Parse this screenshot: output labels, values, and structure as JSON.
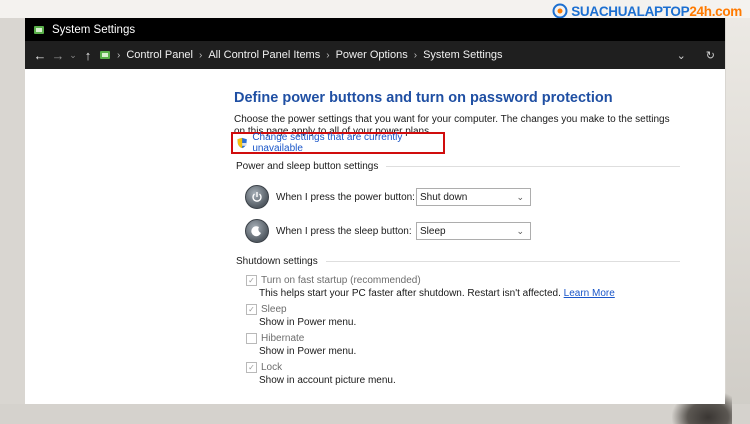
{
  "window": {
    "title": "System Settings"
  },
  "address": {
    "crumbs": [
      "Control Panel",
      "All Control Panel Items",
      "Power Options",
      "System Settings"
    ]
  },
  "page": {
    "heading": "Define power buttons and turn on password protection",
    "description": "Choose the power settings that you want for your computer. The changes you make to the settings on this page apply to all of your power plans.",
    "change_link": "Change settings that are currently unavailable"
  },
  "power_section": {
    "title": "Power and sleep button settings",
    "power_label": "When I press the power button:",
    "power_value": "Shut down",
    "sleep_label": "When I press the sleep button:",
    "sleep_value": "Sleep"
  },
  "shutdown_section": {
    "title": "Shutdown settings",
    "options": [
      {
        "label": "Turn on fast startup (recommended)",
        "sub": "This helps start your PC faster after shutdown. Restart isn't affected.",
        "link": "Learn More",
        "checked": true
      },
      {
        "label": "Sleep",
        "sub": "Show in Power menu.",
        "checked": true
      },
      {
        "label": "Hibernate",
        "sub": "Show in Power menu.",
        "checked": false
      },
      {
        "label": "Lock",
        "sub": "Show in account picture menu.",
        "checked": true
      }
    ]
  },
  "watermark": {
    "prefix": "SUACHUALAPTOP",
    "suffix": "24h.com"
  },
  "colors": {
    "link": "#1a56c9",
    "heading": "#1f4fa3",
    "highlight_border": "#d00d0d",
    "titlebar": "#000000"
  }
}
